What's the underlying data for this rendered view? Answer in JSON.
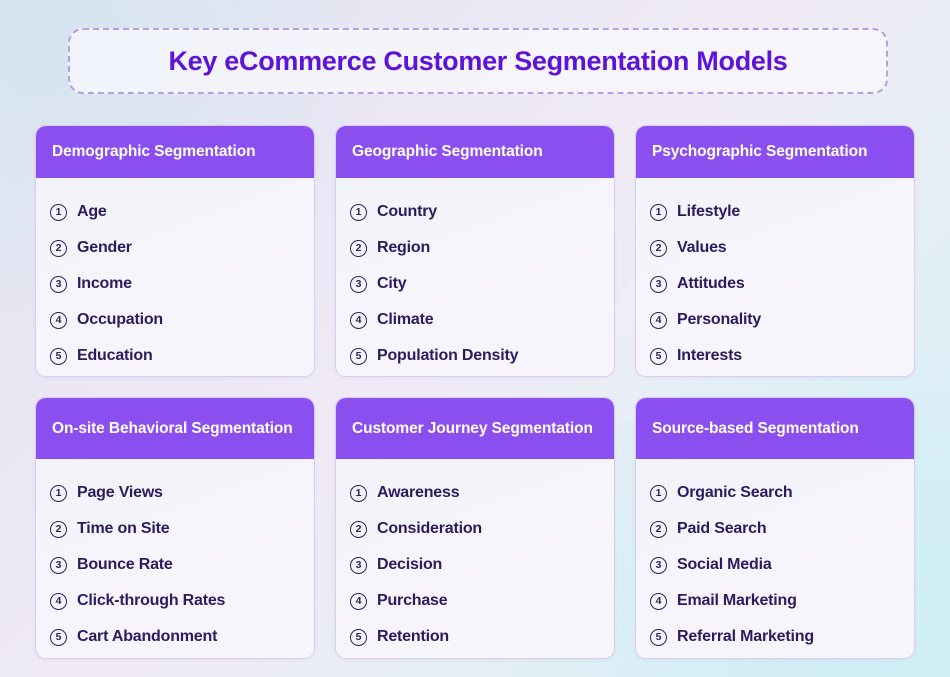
{
  "title": "Key eCommerce Customer Segmentation Models",
  "colors": {
    "header_purple": "#8b4ff0",
    "title_violet": "#5d13d8",
    "item_text": "#2d1b5e",
    "card_body": "#f7f5fb",
    "dashed_border": "#b5a0e0",
    "card_border": "#d9cdf0"
  },
  "cards": [
    {
      "title": "Demographic Segmentation",
      "items": [
        {
          "num": "1",
          "label": "Age"
        },
        {
          "num": "2",
          "label": "Gender"
        },
        {
          "num": "3",
          "label": "Income"
        },
        {
          "num": "4",
          "label": "Occupation"
        },
        {
          "num": "5",
          "label": "Education"
        }
      ]
    },
    {
      "title": "Geographic Segmentation",
      "items": [
        {
          "num": "1",
          "label": "Country"
        },
        {
          "num": "2",
          "label": "Region"
        },
        {
          "num": "3",
          "label": "City"
        },
        {
          "num": "4",
          "label": "Climate"
        },
        {
          "num": "5",
          "label": "Population Density"
        }
      ]
    },
    {
      "title": "Psychographic Segmentation",
      "items": [
        {
          "num": "1",
          "label": "Lifestyle"
        },
        {
          "num": "2",
          "label": "Values"
        },
        {
          "num": "3",
          "label": "Attitudes"
        },
        {
          "num": "4",
          "label": "Personality"
        },
        {
          "num": "5",
          "label": "Interests"
        }
      ]
    },
    {
      "title": "On-site Behavioral Segmentation",
      "items": [
        {
          "num": "1",
          "label": "Page Views"
        },
        {
          "num": "2",
          "label": "Time on Site"
        },
        {
          "num": "3",
          "label": "Bounce Rate"
        },
        {
          "num": "4",
          "label": "Click-through Rates"
        },
        {
          "num": "5",
          "label": "Cart Abandonment"
        }
      ]
    },
    {
      "title": "Customer Journey Segmentation",
      "items": [
        {
          "num": "1",
          "label": "Awareness"
        },
        {
          "num": "2",
          "label": "Consideration"
        },
        {
          "num": "3",
          "label": "Decision"
        },
        {
          "num": "4",
          "label": "Purchase"
        },
        {
          "num": "5",
          "label": "Retention"
        }
      ]
    },
    {
      "title": "Source-based Segmentation",
      "items": [
        {
          "num": "1",
          "label": "Organic Search"
        },
        {
          "num": "2",
          "label": "Paid Search"
        },
        {
          "num": "3",
          "label": "Social Media"
        },
        {
          "num": "4",
          "label": "Email Marketing"
        },
        {
          "num": "5",
          "label": "Referral Marketing"
        }
      ]
    }
  ]
}
